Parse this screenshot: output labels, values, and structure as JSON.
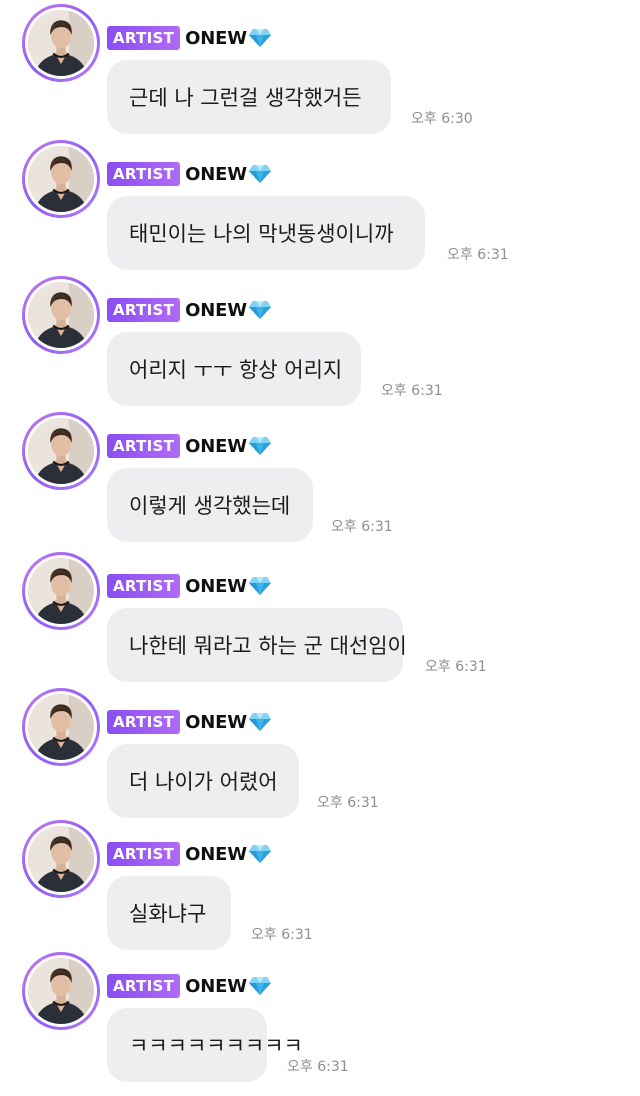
{
  "badge_label": "ARTIST",
  "artist_name": "ONEW",
  "icons": {
    "verified": "diamond-icon"
  },
  "colors": {
    "badge_gradient_start": "#8a4ff2",
    "badge_gradient_end": "#b06af5",
    "bubble_background": "#eeeef0",
    "avatar_ring": "#a36cf5",
    "timestamp": "#8f8f8f"
  },
  "messages": [
    {
      "text": "근데 나 그런걸 생각했거든",
      "time": "오후 6:30"
    },
    {
      "text": "태민이는 나의 막냇동생이니까",
      "time": "오후 6:31"
    },
    {
      "text": "어리지 ㅜㅜ 항상 어리지",
      "time": "오후 6:31"
    },
    {
      "text": "이렇게 생각했는데",
      "time": "오후 6:31"
    },
    {
      "text": "나한테 뭐라고 하는 군 대선임이",
      "time": "오후 6:31"
    },
    {
      "text": "더 나이가 어렸어",
      "time": "오후 6:31"
    },
    {
      "text": "실화냐구",
      "time": "오후 6:31"
    },
    {
      "text": "ㅋㅋㅋㅋㅋㅋㅋㅋㅋ",
      "time": "오후 6:31"
    }
  ]
}
